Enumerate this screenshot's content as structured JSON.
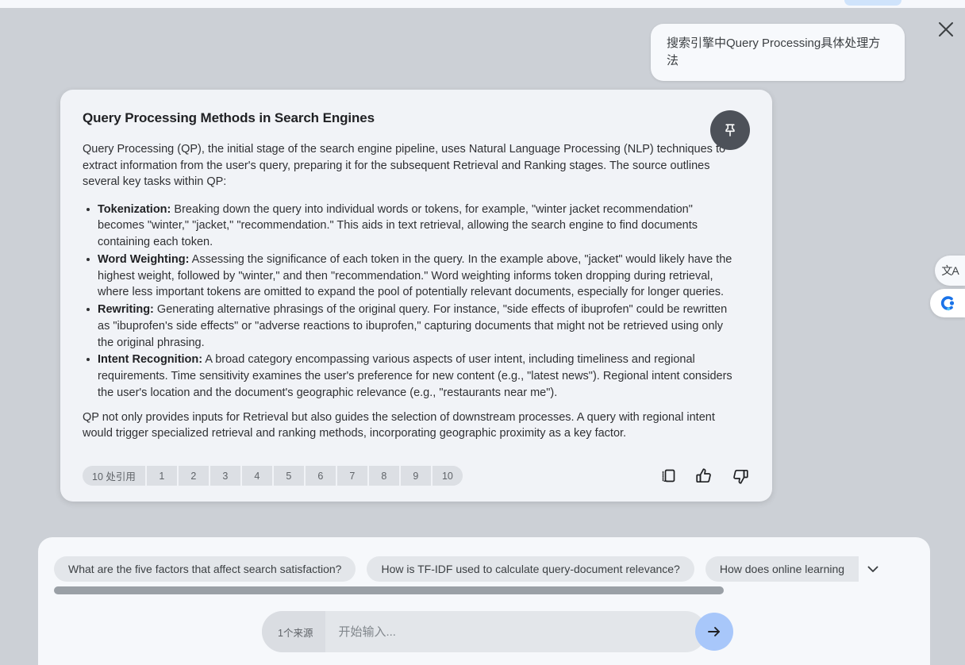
{
  "overlay": {
    "close_icon": "close-icon"
  },
  "user_message": {
    "text": "搜索引擎中Query Processing具体处理方法"
  },
  "answer_card": {
    "title": "Query Processing Methods in Search Engines",
    "pin_icon": "pushpin-icon",
    "intro": "Query Processing (QP), the initial stage of the search engine pipeline, uses Natural Language Processing (NLP) techniques to extract information from the user's query, preparing it for the subsequent Retrieval and Ranking stages. The source outlines several key tasks within QP:",
    "bullets": [
      {
        "term": "Tokenization:",
        "body": " Breaking down the query into individual words or tokens, for example, \"winter jacket recommendation\" becomes \"winter,\" \"jacket,\" \"recommendation.\" This aids in text retrieval, allowing the search engine to find documents containing each token."
      },
      {
        "term": "Word Weighting:",
        "body": " Assessing the significance of each token in the query. In the example above, \"jacket\" would likely have the highest weight, followed by \"winter,\" and then \"recommendation.\" Word weighting informs token dropping during retrieval, where less important tokens are omitted to expand the pool of potentially relevant documents, especially for longer queries."
      },
      {
        "term": "Rewriting:",
        "body": " Generating alternative phrasings of the original query. For instance, \"side effects of ibuprofen\" could be rewritten as \"ibuprofen's side effects\" or \"adverse reactions to ibuprofen,\" capturing documents that might not be retrieved using only the original phrasing."
      },
      {
        "term": "Intent Recognition:",
        "body": " A broad category encompassing various aspects of user intent, including timeliness and regional requirements. Time sensitivity examines the user's preference for new content (e.g., \"latest news\"). Regional intent considers the user's location and the document's geographic relevance (e.g., \"restaurants near me\")."
      }
    ],
    "outro": "QP not only provides inputs for Retrieval but also guides the selection of downstream processes. A query with regional intent would trigger specialized retrieval and ranking methods, incorporating geographic proximity as a key factor.",
    "citations": {
      "label": "10 处引用",
      "numbers": [
        "1",
        "2",
        "3",
        "4",
        "5",
        "6",
        "7",
        "8",
        "9",
        "10"
      ]
    },
    "actions": [
      {
        "name": "copy-icon"
      },
      {
        "name": "thumbs-up-icon"
      },
      {
        "name": "thumbs-down-icon"
      }
    ]
  },
  "suggestions": {
    "chips": [
      "What are the five factors that affect search satisfaction?",
      "How is TF-IDF used to calculate query-document relevance?",
      "How does online learning"
    ],
    "expand_icon": "chevron-down-icon"
  },
  "composer": {
    "source_label": "1个来源",
    "placeholder": "开始输入...",
    "value": "",
    "send_icon": "arrow-right-icon"
  },
  "floating": {
    "translate_glyph": "文A",
    "translate_icon": "translate-icon",
    "assistant_icon": "assistant-logo-icon"
  },
  "colors": {
    "accent_send": "#a8c7fa",
    "overlay_backdrop": "#ccd0d6",
    "card_bg": "#f1f3f7",
    "panel_bg": "#f6f8fb"
  }
}
